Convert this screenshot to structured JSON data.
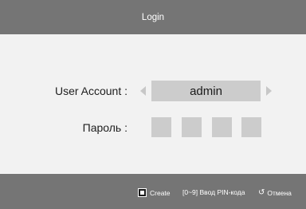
{
  "header": {
    "title": "Login"
  },
  "form": {
    "account_label": "User Account :",
    "account_value": "admin",
    "password_label": "Пароль :",
    "pin_digits": 4
  },
  "footer": {
    "create_label": "Create",
    "pin_hint": "[0~9] Ввод PIN-кода",
    "cancel_label": "Отмена"
  },
  "colors": {
    "bar": "#757575",
    "background": "#f2f2f2",
    "field": "#cccccc",
    "arrow": "#c7c7c7"
  },
  "icons": {
    "create": "a-button-icon",
    "cancel": "return-icon",
    "prev": "arrow-left-icon",
    "next": "arrow-right-icon"
  }
}
